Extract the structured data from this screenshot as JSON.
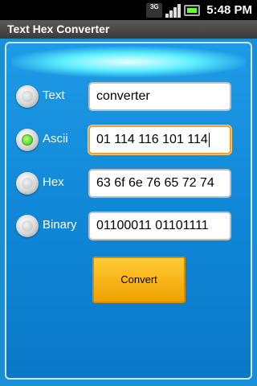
{
  "status": {
    "time": "5:48 PM",
    "network": "3G"
  },
  "app": {
    "title": "Text Hex Converter"
  },
  "rows": [
    {
      "id": "text",
      "label": "Text",
      "value": "converter",
      "checked": false
    },
    {
      "id": "ascii",
      "label": "Ascii",
      "value": "01 114 116 101 114",
      "checked": true
    },
    {
      "id": "hex",
      "label": "Hex",
      "value": "63 6f 6e 76 65 72 74",
      "checked": false
    },
    {
      "id": "binary",
      "label": "Binary",
      "value": "01100011 01101111",
      "checked": false
    }
  ],
  "convert_label": "Convert",
  "colors": {
    "panel": "#1e9be6",
    "button": "#ffb51a",
    "checked_radio": "#2bbf15"
  }
}
